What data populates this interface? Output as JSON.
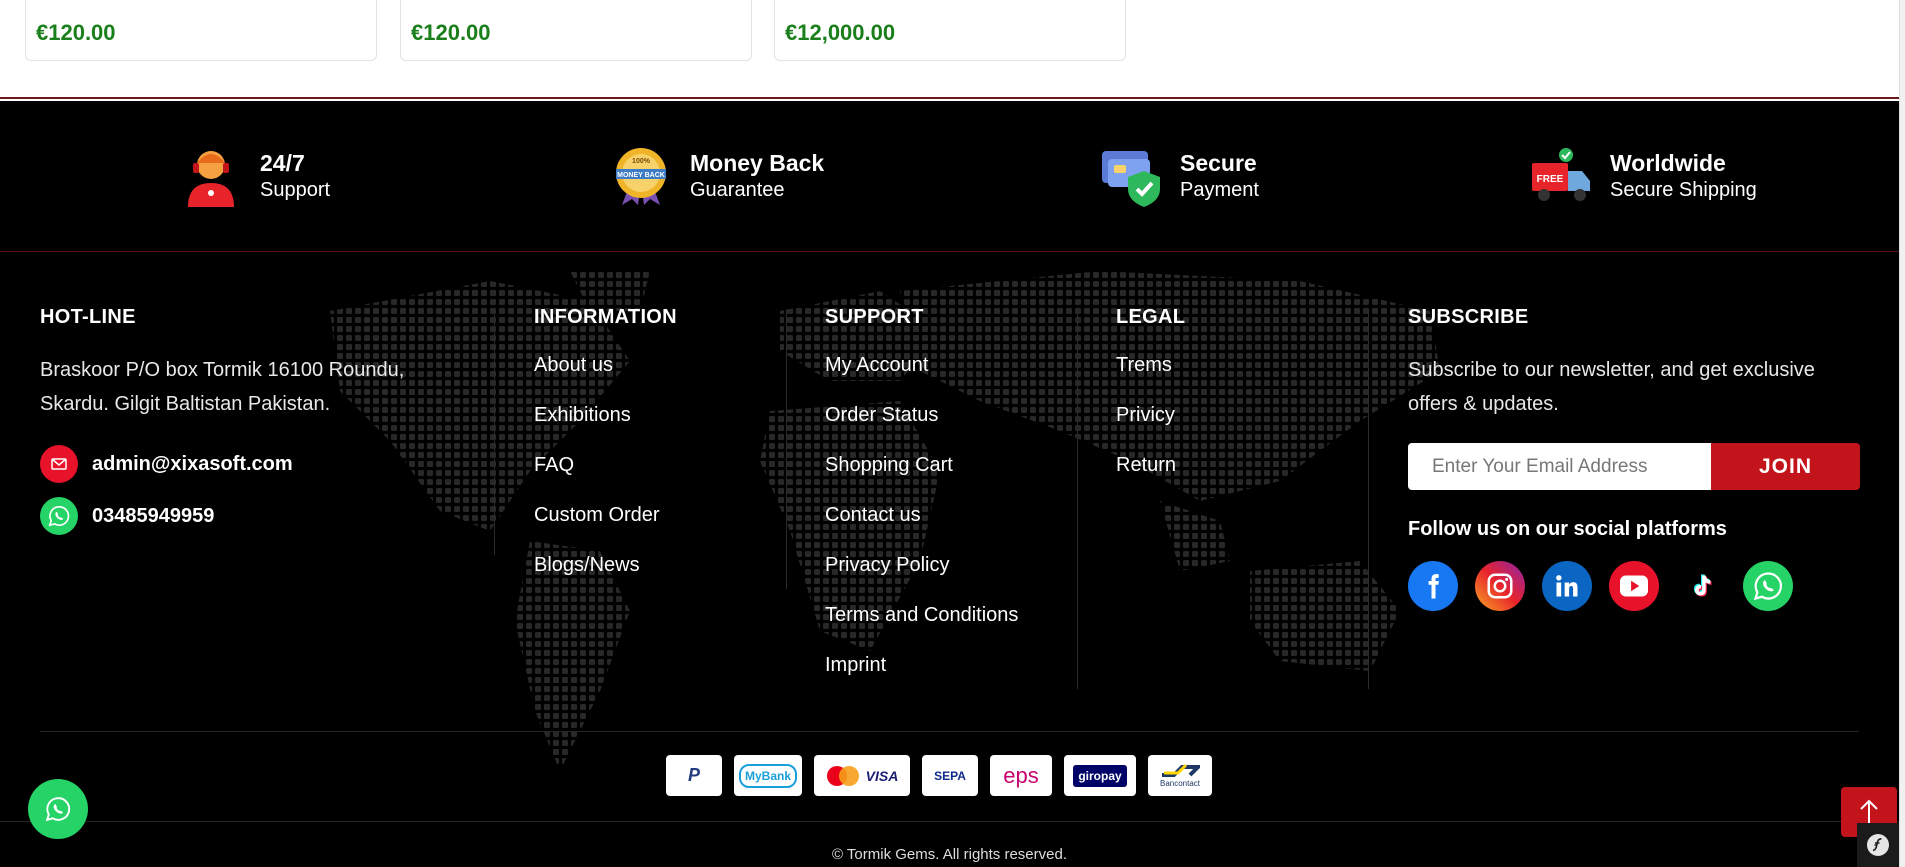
{
  "products": [
    {
      "price": "€120.00"
    },
    {
      "price": "€120.00"
    },
    {
      "price": "€12,000.00"
    }
  ],
  "features": [
    {
      "title": "24/7",
      "subtitle": "Support",
      "icon": "support-agent-icon"
    },
    {
      "title": "Money Back",
      "subtitle": "Guarantee",
      "icon": "money-back-badge-icon"
    },
    {
      "title": "Secure",
      "subtitle": "Payment",
      "icon": "secure-payment-icon"
    },
    {
      "title": "Worldwide",
      "subtitle": "Secure Shipping",
      "icon": "free-shipping-truck-icon"
    }
  ],
  "hotline": {
    "title": "HOT-LINE",
    "address": "Braskoor P/O box Tormik 16100 Roundu, Skardu. Gilgit Baltistan Pakistan.",
    "email": "admin@xixasoft.com",
    "phone": "03485949959"
  },
  "information": {
    "title": "INFORMATION",
    "links": [
      "About us",
      "Exhibitions",
      "FAQ",
      "Custom Order",
      "Blogs/News"
    ]
  },
  "support": {
    "title": "SUPPORT",
    "links": [
      "My Account",
      "Order Status",
      "Shopping Cart",
      "Contact us",
      "Privacy Policy",
      "Terms and Conditions",
      "Imprint"
    ]
  },
  "legal": {
    "title": "LEGAL",
    "links": [
      "Trems",
      "Privicy",
      "Return"
    ]
  },
  "subscribe": {
    "title": "SUBSCRIBE",
    "text": "Subscribe to our newsletter, and get exclusive offers & updates.",
    "placeholder": "Enter Your Email Address",
    "button": "JOIN",
    "follow_title": "Follow us on our social platforms"
  },
  "socials": [
    "facebook",
    "instagram",
    "linkedin",
    "youtube",
    "tiktok",
    "whatsapp"
  ],
  "payments": [
    {
      "name": "paypal",
      "label": "P"
    },
    {
      "name": "mybank",
      "label": "MyBank"
    },
    {
      "name": "mastercard-visa",
      "label": "VISA"
    },
    {
      "name": "sepa",
      "label": "SEPA"
    },
    {
      "name": "eps",
      "label": "eps"
    },
    {
      "name": "giropay",
      "label": "giropay"
    },
    {
      "name": "bancontact",
      "label": "Bancontact"
    }
  ],
  "copyright": "© Tormik Gems. All rights reserved.",
  "colors": {
    "accent": "#c4141b",
    "price": "#1a7f1a",
    "whatsapp": "#25d366",
    "footer_bg": "#000000"
  }
}
